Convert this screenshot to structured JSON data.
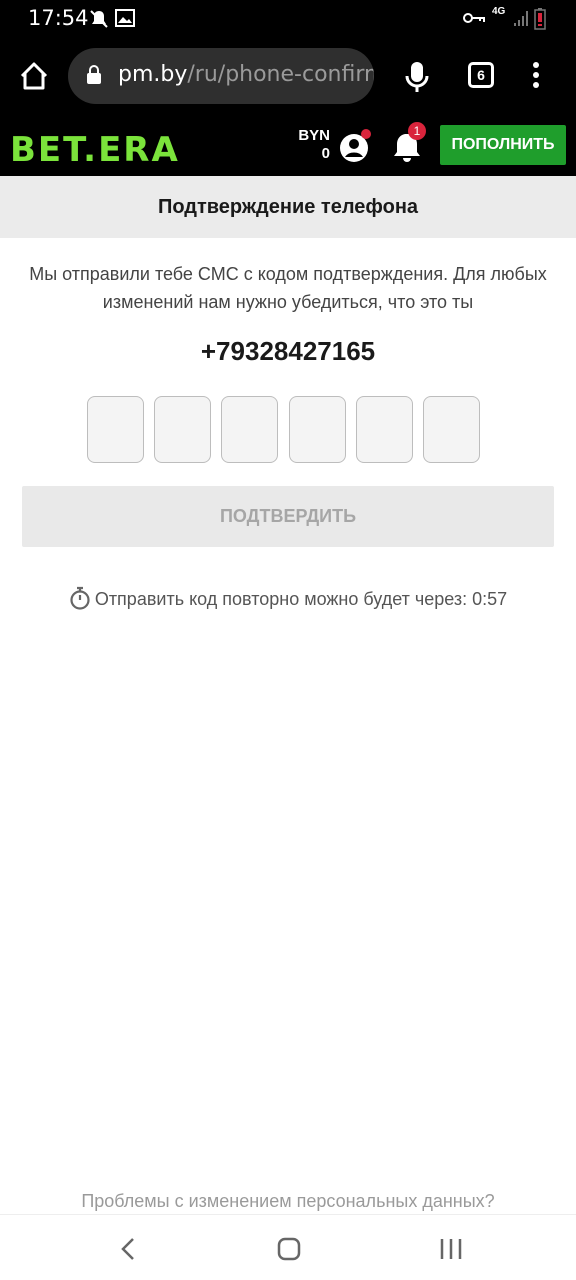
{
  "status_bar": {
    "time": "17:54",
    "network": "4G"
  },
  "browser": {
    "url_host": "pm.by",
    "url_path": "/ru/phone-confirm",
    "tab_count": "6"
  },
  "header": {
    "logo": "BET.ERA",
    "currency": "BYN",
    "balance": "0",
    "notification_count": "1",
    "deposit_label": "ПОПОЛНИТЬ",
    "logo_color": "#7be33b",
    "deposit_color": "#1f9e2c"
  },
  "page": {
    "title": "Подтверждение телефона",
    "description": "Мы отправили тебе СМС с кодом подтверждения. Для любых изменений нам нужно убедиться, что это ты",
    "phone_number": "+79328427165",
    "code_digits": [
      "",
      "",
      "",
      "",
      "",
      ""
    ],
    "confirm_label": "ПОДТВЕРДИТЬ",
    "resend_text": "Отправить код повторно можно будет через: 0:57",
    "problems_link": "Проблемы с изменением персональных данных?"
  }
}
